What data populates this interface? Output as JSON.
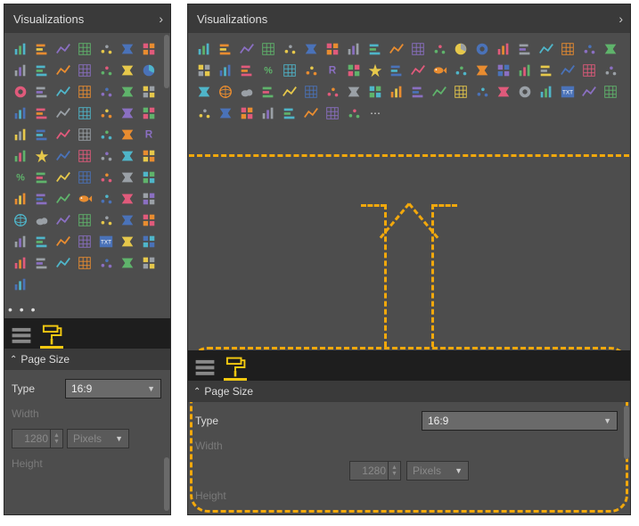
{
  "narrow": {
    "title": "Visualizations",
    "page_size_label": "Page Size",
    "type_label": "Type",
    "type_value": "16:9",
    "width_label": "Width",
    "width_value": "1280",
    "width_unit": "Pixels",
    "height_label": "Height",
    "more_dots": "• • •",
    "viz_icons": [
      "stacked-bar",
      "clustered-column",
      "stacked-bar-h",
      "clustered-bar-h",
      "stacked-100",
      "line",
      "area",
      "line-stacked",
      "line-column",
      "ribbon",
      "waterfall",
      "line-clustered",
      "scatter",
      "pie",
      "donut",
      "treemap",
      "matrix",
      "table",
      "funnel",
      "gauge",
      "card",
      "multi-card",
      "kpi",
      "slicer",
      "map",
      "filled-map",
      "shape-map",
      "arcgis",
      "python",
      "key-influencers",
      "qa",
      "decomposition",
      "more-1",
      "more-2",
      "r-script",
      "more-3",
      "star",
      "bullet",
      "network",
      "custom-1",
      "custom-2",
      "custom-3",
      "percent",
      "heatmap",
      "custom-4",
      "custom-5",
      "histogram",
      "custom-6",
      "candlestick",
      "pyramid",
      "custom-7",
      "custom-8",
      "fish",
      "radar",
      "custom-9",
      "custom-10",
      "globe",
      "cloud",
      "custom-11",
      "custom-12",
      "custom-13",
      "custom-14",
      "tornado",
      "custom-15",
      "custom-16",
      "custom-17",
      "custom-18",
      "txt",
      "custom-19",
      "custom-20",
      "custom-21",
      "custom-22",
      "custom-23",
      "custom-24",
      "custom-25",
      "custom-26",
      "custom-27",
      "custom-28"
    ]
  },
  "wide": {
    "title": "Visualizations",
    "page_size_label": "Page Size",
    "type_label": "Type",
    "type_value": "16:9",
    "width_label": "Width",
    "width_value": "1280",
    "width_unit": "Pixels",
    "height_label": "Height",
    "more_dots": "• • •",
    "viz_icons": [
      "stacked-bar",
      "clustered-column",
      "stacked-bar-h",
      "clustered-bar-h",
      "stacked-100",
      "line",
      "area",
      "line-stacked",
      "line-column",
      "ribbon",
      "waterfall",
      "scatter",
      "pie",
      "donut",
      "treemap",
      "matrix",
      "table",
      "slicer",
      "funnel",
      "gauge",
      "card",
      "multi-card",
      "kpi",
      "percent",
      "map",
      "filled-map",
      "r-script",
      "python",
      "star",
      "bullet",
      "network",
      "fish",
      "radar",
      "custom-a",
      "custom-b",
      "custom-c",
      "custom-d",
      "candlestick",
      "pyramid",
      "qa",
      "custom-e",
      "globe",
      "cloud",
      "custom-f",
      "custom-g",
      "custom-h",
      "custom-i",
      "custom-j",
      "custom-k",
      "custom-l",
      "custom-m",
      "custom-n",
      "custom-o",
      "custom-p",
      "custom-q",
      "donut-2",
      "custom-r",
      "txt",
      "custom-s",
      "custom-t",
      "custom-u",
      "custom-v",
      "custom-w",
      "custom-x",
      "custom-y",
      "custom-z",
      "custom-aa",
      "custom-ab"
    ]
  }
}
